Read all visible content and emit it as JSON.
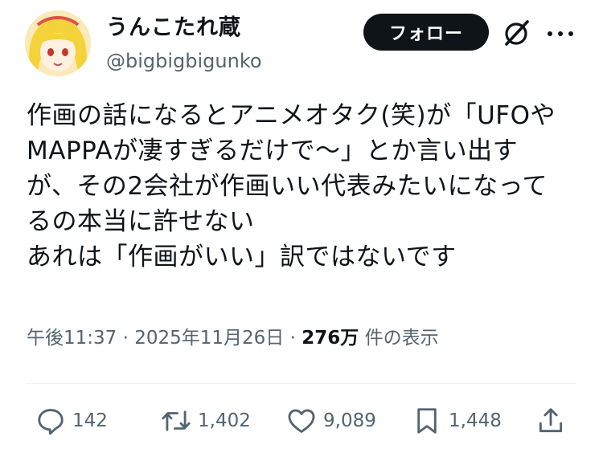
{
  "author": {
    "display_name": "うんこたれ蔵",
    "handle": "@bigbigbigunko"
  },
  "header": {
    "follow_label": "フォロー"
  },
  "tweet": {
    "text": "作画の話になるとアニメオタク(笑)が「UFOや\nMAPPAが凄すぎるだけで〜」とか言い出す\nが、その2会社が作画いい代表みたいになって\nるの本当に許せない\nあれは「作画がいい」訳ではないです",
    "time": "午後11:37",
    "date": "2025年11月26日",
    "separator": "·",
    "views_count": "276万",
    "views_label": "件の表示"
  },
  "actions": {
    "replies": "142",
    "reposts": "1,402",
    "likes": "9,089",
    "bookmarks": "1,448"
  },
  "icons": {
    "reply": "reply-bubble-icon",
    "repost": "repost-icon",
    "like": "heart-icon",
    "bookmark": "bookmark-icon",
    "share": "share-icon",
    "grok": "grok-icon",
    "more": "more-icon"
  },
  "colors": {
    "text": "#0f1419",
    "secondary": "#536471",
    "button_bg": "#0f1419"
  }
}
